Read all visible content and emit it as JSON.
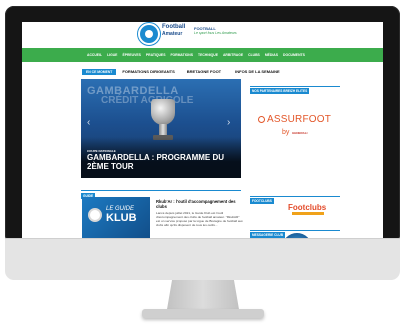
{
  "site": {
    "brand_line1": "Football",
    "brand_line2": "Amateur",
    "brand_right": "FOOTBALL",
    "tagline": "Le sport fous Les Amateurs"
  },
  "nav": [
    "ACCUEIL",
    "LIGUE",
    "ÉPREUVES",
    "PRATIQUES",
    "FORMATIONS",
    "TECHNIQUE",
    "ARBITRAGE",
    "CLUBS",
    "MÉDIAS",
    "DOCUMENTS"
  ],
  "ticker": {
    "tag": "EN CE MOMENT",
    "items": [
      "FORMATIONS DIRIGEANTS",
      "BRETAGNE FOOT",
      "INFOS DE LA SEMAINE"
    ]
  },
  "hero": {
    "bg_text_1": "GAMBARDELLA",
    "bg_text_2": "CRÉDIT AGRICOLE",
    "category": "COUPE NATIONALE",
    "title": "GAMBARDELLA : PROGRAMME DU 2ÈME TOUR"
  },
  "sidebar": {
    "partners_heading": "NOS PARTENAIRES BREIZH ELITES",
    "assurfoot": "ASSURFOOT",
    "assurfoot_by": "by",
    "generali": "GENERALI",
    "footclubs_heading": "FOOTCLUBS",
    "footclubs": "Footclubs",
    "messagerie_heading": "MESSAGERIE CLUB"
  },
  "guide": {
    "section": "GUIDE",
    "img_le": "LE GUIDE",
    "img_klub": "KLUB",
    "title": "Rkub'Ar : l'outil d'accompagnement des clubs",
    "body": "Lancé depuis juillet 2021, le Guide Klub est l'outil d'accompagnement des clubs de football amateur. \"RkubAR\" est un service proposé par la Ligue de Bretagne de football aux clubs afin qu'ils disposent de tous les outils..."
  }
}
